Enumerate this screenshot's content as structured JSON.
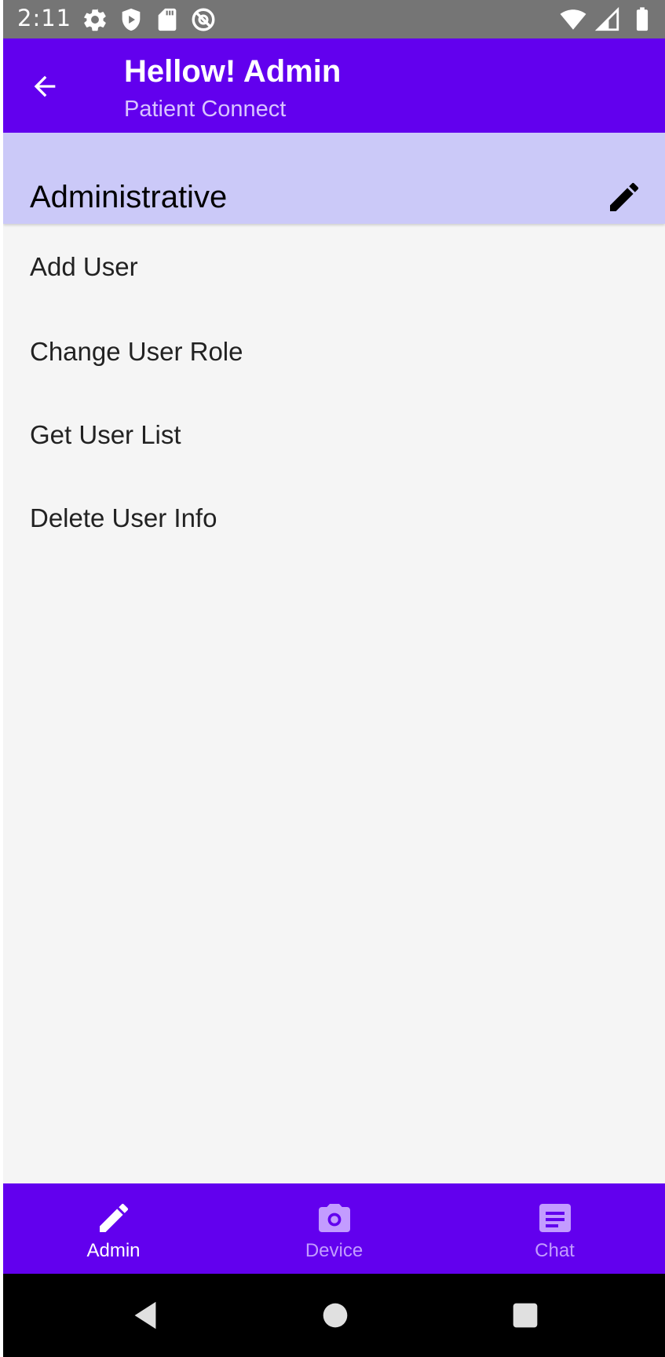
{
  "status_bar": {
    "time": "2:11",
    "left_icons": [
      "settings-icon",
      "shield-play-icon",
      "sd-card-icon",
      "no-location-icon"
    ],
    "right_icons": [
      "wifi-icon",
      "cell-signal-icon",
      "battery-icon"
    ]
  },
  "app_bar": {
    "title": "Hellow! Admin",
    "subtitle": "Patient Connect",
    "back_icon": "arrow-back-icon",
    "color": "#6200ee"
  },
  "section": {
    "title": "Administrative",
    "edit_icon": "pencil-icon",
    "background": "#cbc9f8"
  },
  "menu": {
    "items": [
      {
        "label": "Add User"
      },
      {
        "label": "Change User Role"
      },
      {
        "label": "Get User List"
      },
      {
        "label": "Delete User Info"
      }
    ]
  },
  "bottom_nav": {
    "items": [
      {
        "label": "Admin",
        "icon": "pencil-icon",
        "active": true
      },
      {
        "label": "Device",
        "icon": "camera-icon",
        "active": false
      },
      {
        "label": "Chat",
        "icon": "message-icon",
        "active": false
      }
    ],
    "active_color": "#ffffff",
    "inactive_color": "#c39cff"
  },
  "system_nav": {
    "icons": [
      "back-triangle-icon",
      "home-circle-icon",
      "recents-square-icon"
    ]
  }
}
